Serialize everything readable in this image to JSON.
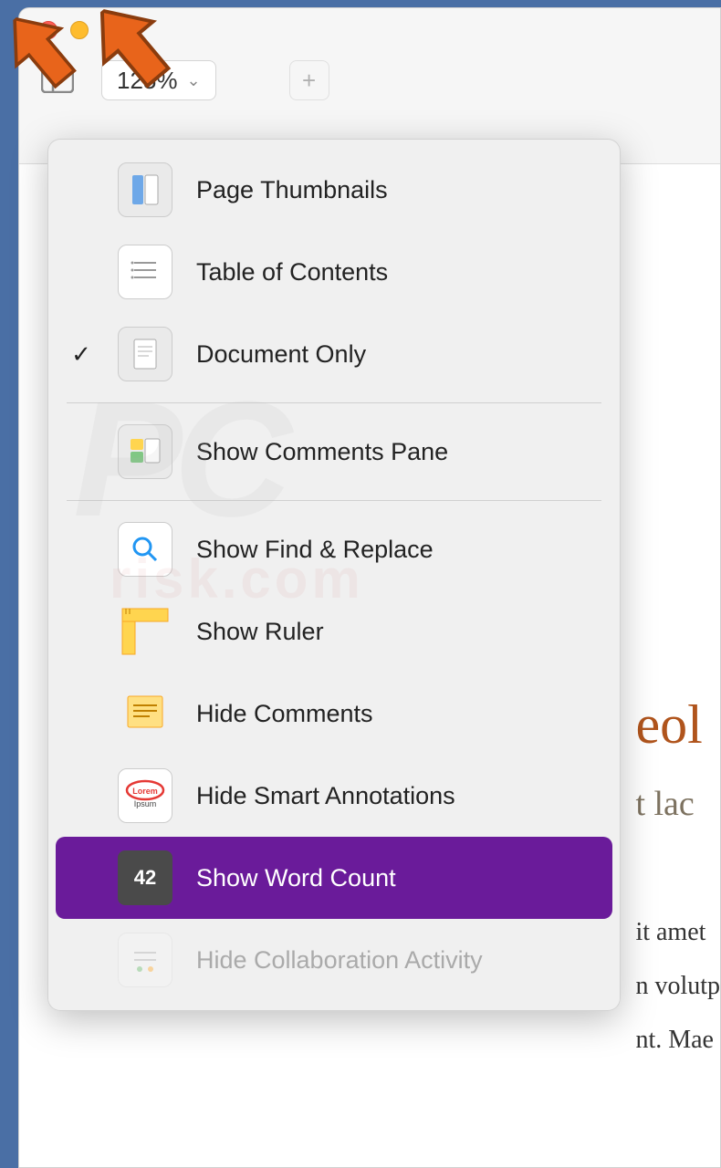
{
  "toolbar": {
    "zoom": "125%"
  },
  "menu": {
    "items": [
      {
        "label": "Page Thumbnails",
        "checked": false,
        "icon": "thumbnails"
      },
      {
        "label": "Table of Contents",
        "checked": false,
        "icon": "toc"
      },
      {
        "label": "Document Only",
        "checked": true,
        "icon": "document"
      }
    ],
    "items2": [
      {
        "label": "Show Comments Pane",
        "icon": "comments-pane"
      }
    ],
    "items3": [
      {
        "label": "Show Find & Replace",
        "icon": "search"
      },
      {
        "label": "Show Ruler",
        "icon": "ruler"
      },
      {
        "label": "Hide Comments",
        "icon": "note"
      },
      {
        "label": "Hide Smart Annotations",
        "icon": "lorem"
      },
      {
        "label": "Show Word Count",
        "icon": "wordcount",
        "selected": true
      },
      {
        "label": "Hide Collaboration Activity",
        "icon": "collab",
        "disabled": true
      }
    ],
    "wordcount_value": "42"
  },
  "document": {
    "title_fragment": "eol",
    "subtitle_fragment": "t lac",
    "body_fragments": [
      "it amet",
      "n volutp",
      "nt. Mae"
    ]
  },
  "watermark": {
    "main": "PC",
    "sub": "risk.com"
  }
}
